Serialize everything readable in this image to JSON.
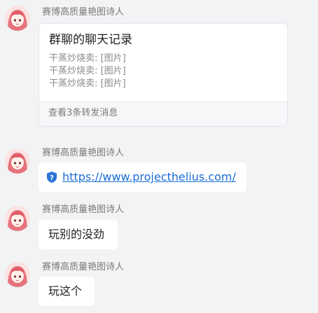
{
  "messages": [
    {
      "sender": "赛博高质量艳图诗人",
      "type": "forward",
      "card": {
        "title": "群聊的聊天记录",
        "lines": [
          "干蒸炒烧卖: [图片]",
          "干蒸炒烧卖: [图片]",
          "干蒸炒烧卖: [图片]"
        ],
        "footer": "查看3条转发消息"
      }
    },
    {
      "sender": "赛博高质量艳图诗人",
      "type": "link",
      "icon": "shield-question-icon",
      "text": "https://www.projecthelius.com/"
    },
    {
      "sender": "赛博高质量艳图诗人",
      "type": "text",
      "text": "玩别的没劲"
    },
    {
      "sender": "赛博高质量艳图诗人",
      "type": "text",
      "text": "玩这个"
    }
  ],
  "colors": {
    "background": "#f2f3f5",
    "bubble": "#ffffff",
    "link": "#1a6ed8",
    "sender": "#7b7b7b",
    "link_icon": "#2b74d8"
  }
}
